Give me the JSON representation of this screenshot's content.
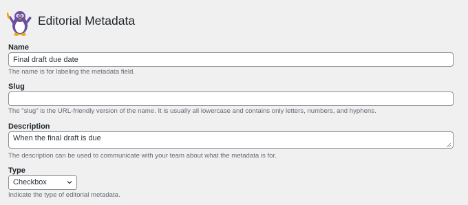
{
  "header": {
    "title": "Editorial Metadata",
    "logo_icon": "penguin-mascot-logo"
  },
  "fields": {
    "name": {
      "label": "Name",
      "value": "Final draft due date",
      "help": "The name is for labeling the metadata field."
    },
    "slug": {
      "label": "Slug",
      "value": "",
      "help": "The \"slug\" is the URL-friendly version of the name. It is usually all lowercase and contains only letters, numbers, and hyphens."
    },
    "description": {
      "label": "Description",
      "value": "When the final draft is due",
      "help": "The description can be used to communicate with your team about what the metadata is for."
    },
    "type": {
      "label": "Type",
      "selected": "Checkbox",
      "help": "Indicate the type of editorial metadata."
    }
  },
  "colors": {
    "background": "#f0f0f1",
    "text": "#1d2327",
    "help_text": "#646970",
    "border": "#8c8f94",
    "logo_purple": "#6b4fa0"
  }
}
